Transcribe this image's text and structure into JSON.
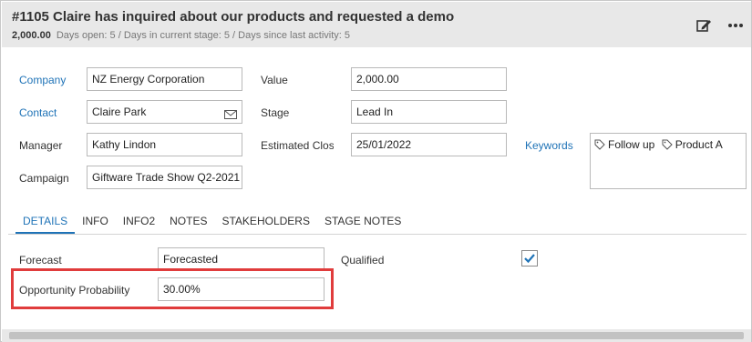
{
  "header": {
    "title": "#1105  Claire has inquired about our products and requested a demo",
    "value": "2,000.00",
    "stats": "Days open: 5 / Days in current stage: 5 / Days since last activity: 5",
    "edit_icon": "edit-icon",
    "more_icon": "more-horizontal-icon"
  },
  "fields": {
    "company": {
      "label": "Company",
      "value": "NZ Energy Corporation"
    },
    "contact": {
      "label": "Contact",
      "value": "Claire Park"
    },
    "manager": {
      "label": "Manager",
      "value": "Kathy Lindon"
    },
    "campaign": {
      "label": "Campaign",
      "value": "Giftware Trade Show Q2-2021"
    },
    "value": {
      "label": "Value",
      "value": "2,000.00"
    },
    "stage": {
      "label": "Stage",
      "value": "Lead In"
    },
    "estimated_close": {
      "label": "Estimated Close",
      "value": "25/01/2022"
    },
    "keywords": {
      "label": "Keywords",
      "tags": [
        "Follow up",
        "Product A"
      ]
    }
  },
  "tabs": [
    "DETAILS",
    "INFO",
    "INFO2",
    "NOTES",
    "STAKEHOLDERS",
    "STAGE NOTES"
  ],
  "active_tab": "DETAILS",
  "details": {
    "forecast": {
      "label": "Forecast",
      "value": "Forecasted"
    },
    "qualified": {
      "label": "Qualified",
      "checked": true
    },
    "probability": {
      "label": "Opportunity Probability",
      "value": "30.00%"
    }
  },
  "colors": {
    "link": "#1f73b7",
    "highlight": "#e03c3c",
    "check": "#1f73b7"
  }
}
